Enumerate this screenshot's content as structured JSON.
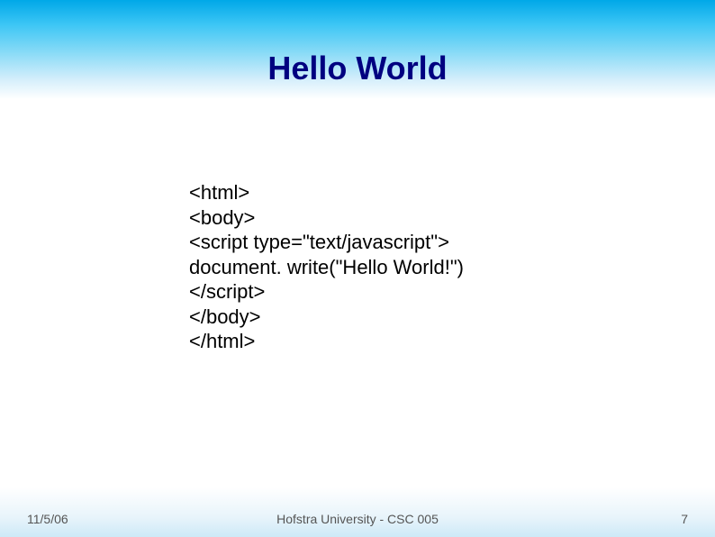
{
  "title": "Hello World",
  "code": {
    "l1": "<html>",
    "l2": "<body>",
    "l3": "<script type=\"text/javascript\">",
    "l4": "document. write(\"Hello World!\")",
    "l5": "</script>",
    "l6": "</body>",
    "l7": "</html>"
  },
  "footer": {
    "date": "11/5/06",
    "center": "Hofstra University - CSC 005",
    "page": "7"
  }
}
